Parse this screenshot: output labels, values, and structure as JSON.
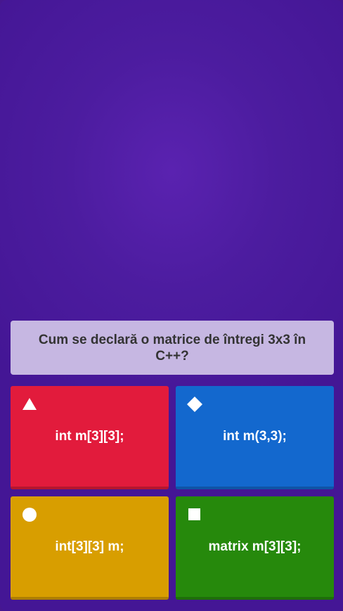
{
  "question": {
    "text": "Cum se declară o matrice de întregi 3x3 în C++?"
  },
  "answers": [
    {
      "label": "int m[3][3];",
      "shape": "triangle-icon",
      "color": "#e21b3c"
    },
    {
      "label": "int m(3,3);",
      "shape": "diamond-icon",
      "color": "#1368ce"
    },
    {
      "label": "int[3][3] m;",
      "shape": "circle-icon",
      "color": "#d89e00"
    },
    {
      "label": "matrix m[3][3];",
      "shape": "square-icon",
      "color": "#26890c"
    }
  ]
}
